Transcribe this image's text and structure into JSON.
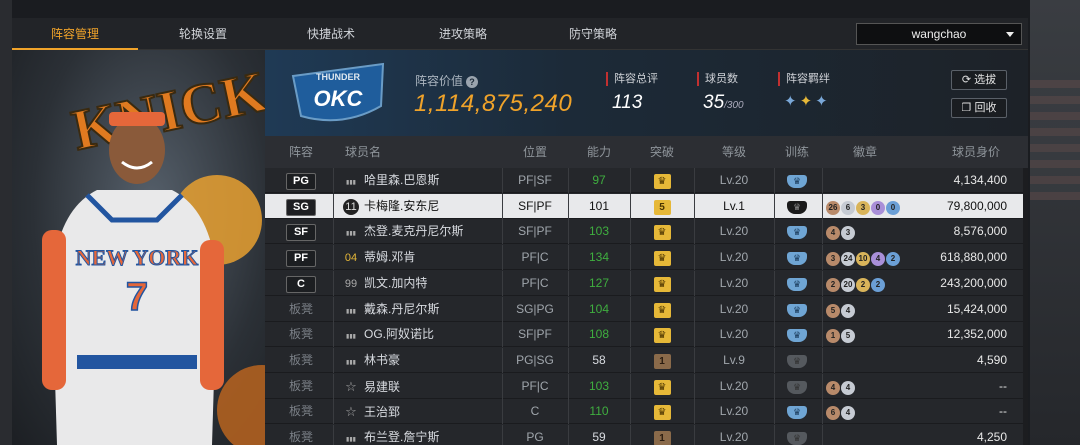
{
  "tabs": [
    "阵容管理",
    "轮换设置",
    "快捷战术",
    "进攻策略",
    "防守策略"
  ],
  "active_tab": 0,
  "user": {
    "name": "wangchao"
  },
  "colors": {
    "accent": "#f0a32a",
    "ability_green": "#3fae3f",
    "stat_marker": "#c23030"
  },
  "poster": {
    "team_text": "KNICKS",
    "jersey_text": "NEW YORK",
    "jersey_number": "7"
  },
  "team_logo": {
    "top": "THUNDER",
    "abbr": "OKC"
  },
  "header": {
    "value_label": "阵容价值",
    "value": "1,114,875,240",
    "rating_label": "阵容总评",
    "rating": "113",
    "players_label": "球员数",
    "players": "35",
    "players_max": "/300",
    "bond_label": "阵容羁绊",
    "filter_button": "选拔",
    "recycle_button": "回收"
  },
  "columns": [
    "阵容",
    "球员名",
    "位置",
    "能力",
    "突破",
    "等级",
    "训练",
    "徽章",
    "球员身价"
  ],
  "rows": [
    {
      "slot": "PG",
      "icon": "signal",
      "name": "哈里森.巴恩斯",
      "position": "PF|SF",
      "ability": "97",
      "break": "crown",
      "level": "Lv.20",
      "train": "blue",
      "badges": [],
      "value": "4,134,400",
      "selected": false
    },
    {
      "slot": "SG",
      "icon": "11",
      "name": "卡梅隆.安东尼",
      "position": "SF|PF",
      "ability": "101",
      "break": "5",
      "level": "Lv.1",
      "train": "black",
      "badges": [
        [
          "26",
          "b-bronze"
        ],
        [
          "6",
          "b-silver"
        ],
        [
          "3",
          "b-gold"
        ],
        [
          "0",
          "b-purple"
        ],
        [
          "0",
          "b-blue"
        ]
      ],
      "value": "79,800,000",
      "selected": true
    },
    {
      "slot": "SF",
      "icon": "signal",
      "name": "杰登.麦克丹尼尔斯",
      "position": "SF|PF",
      "ability": "103",
      "break": "crown",
      "level": "Lv.20",
      "train": "blue",
      "badges": [
        [
          "4",
          "b-bronze"
        ],
        [
          "3",
          "b-silver"
        ]
      ],
      "value": "8,576,000",
      "selected": false
    },
    {
      "slot": "PF",
      "icon": "04",
      "name": "蒂姆.邓肯",
      "position": "PF|C",
      "ability": "134",
      "break": "crown",
      "level": "Lv.20",
      "train": "blue",
      "badges": [
        [
          "3",
          "b-bronze"
        ],
        [
          "24",
          "b-silver"
        ],
        [
          "10",
          "b-gold"
        ],
        [
          "4",
          "b-purple"
        ],
        [
          "2",
          "b-blue"
        ]
      ],
      "value": "618,880,000",
      "selected": false
    },
    {
      "slot": "C",
      "icon": "99",
      "name": "凯文.加内特",
      "position": "PF|C",
      "ability": "127",
      "break": "crown",
      "level": "Lv.20",
      "train": "blue",
      "badges": [
        [
          "2",
          "b-bronze"
        ],
        [
          "20",
          "b-silver"
        ],
        [
          "2",
          "b-gold"
        ],
        [
          "2",
          "b-blue"
        ]
      ],
      "value": "243,200,000",
      "selected": false
    },
    {
      "slot": "板凳",
      "icon": "signal",
      "name": "戴森.丹尼尔斯",
      "position": "SG|PG",
      "ability": "104",
      "break": "crown",
      "level": "Lv.20",
      "train": "blue",
      "badges": [
        [
          "5",
          "b-bronze"
        ],
        [
          "4",
          "b-silver"
        ]
      ],
      "value": "15,424,000",
      "selected": false
    },
    {
      "slot": "板凳",
      "icon": "signal",
      "name": "OG.阿奴诺比",
      "position": "SF|PF",
      "ability": "108",
      "break": "crown",
      "level": "Lv.20",
      "train": "blue",
      "badges": [
        [
          "1",
          "b-bronze"
        ],
        [
          "5",
          "b-silver"
        ]
      ],
      "value": "12,352,000",
      "selected": false
    },
    {
      "slot": "板凳",
      "icon": "signal",
      "name": "林书豪",
      "position": "PG|SG",
      "ability": "58",
      "break": "1",
      "level": "Lv.9",
      "train": "dark",
      "badges": [],
      "value": "4,590",
      "selected": false
    },
    {
      "slot": "板凳",
      "icon": "star",
      "name": "易建联",
      "position": "PF|C",
      "ability": "103",
      "break": "crown",
      "level": "Lv.20",
      "train": "dark",
      "badges": [
        [
          "4",
          "b-bronze"
        ],
        [
          "4",
          "b-silver"
        ]
      ],
      "value": "--",
      "selected": false
    },
    {
      "slot": "板凳",
      "icon": "star",
      "name": "王治郅",
      "position": "C",
      "ability": "110",
      "break": "crown",
      "level": "Lv.20",
      "train": "blue",
      "badges": [
        [
          "6",
          "b-bronze"
        ],
        [
          "4",
          "b-silver"
        ]
      ],
      "value": "--",
      "selected": false
    },
    {
      "slot": "板凳",
      "icon": "signal",
      "name": "布兰登.詹宁斯",
      "position": "PG",
      "ability": "59",
      "break": "1",
      "level": "Lv.20",
      "train": "dark",
      "badges": [],
      "value": "4,250",
      "selected": false
    }
  ]
}
